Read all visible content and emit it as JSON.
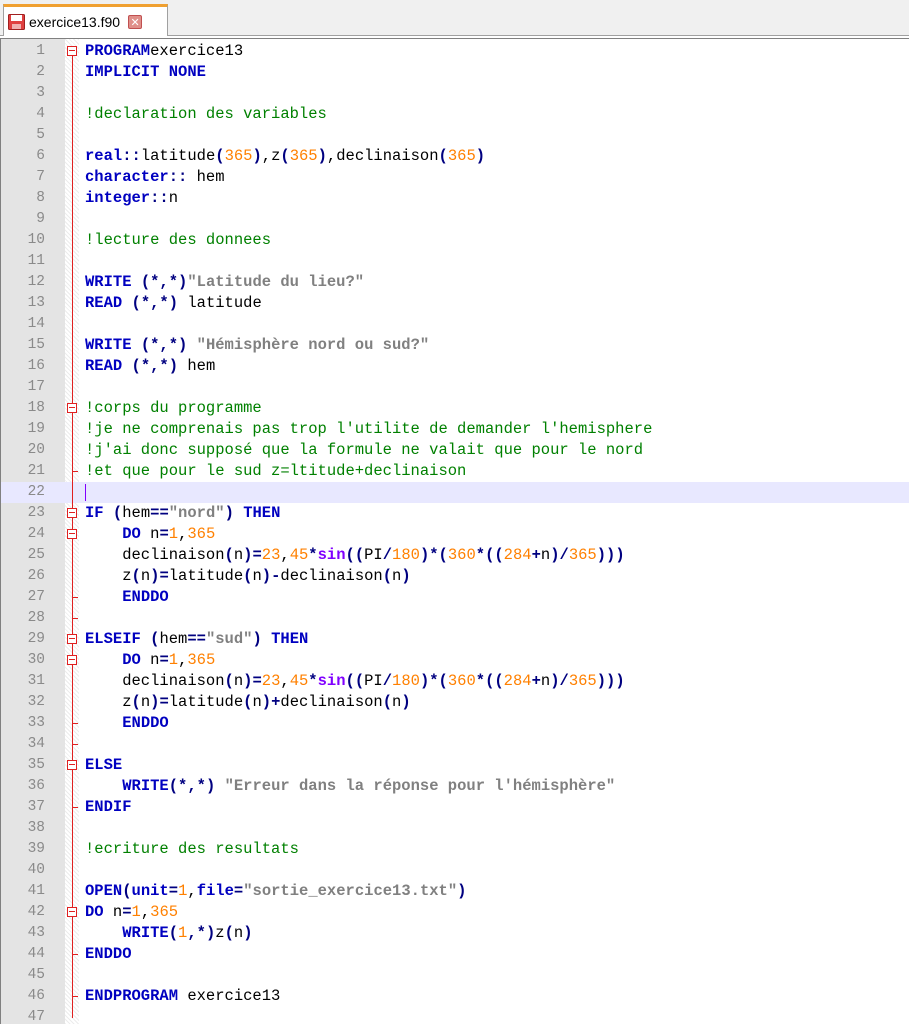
{
  "window": {
    "tab_title": "exercice13.f90",
    "tab_icon": "floppy-disk-icon",
    "close_icon": "close-icon"
  },
  "editor": {
    "current_line": 22,
    "lines": [
      {
        "n": "1",
        "t": [
          [
            "kw",
            "PROGRAM"
          ],
          [
            "",
            "exercice13"
          ]
        ]
      },
      {
        "n": "2",
        "t": [
          [
            "kw",
            "IMPLICIT NONE"
          ]
        ]
      },
      {
        "n": "3",
        "t": []
      },
      {
        "n": "4",
        "t": [
          [
            "cm",
            "!declaration des variables"
          ]
        ]
      },
      {
        "n": "5",
        "t": []
      },
      {
        "n": "6",
        "t": [
          [
            "kw",
            "real"
          ],
          [
            "op",
            "::"
          ],
          [
            "",
            "latitude"
          ],
          [
            "op",
            "("
          ],
          [
            "nm",
            "365"
          ],
          [
            "op",
            ")"
          ],
          [
            "",
            ",z"
          ],
          [
            "op",
            "("
          ],
          [
            "nm",
            "365"
          ],
          [
            "op",
            ")"
          ],
          [
            "",
            ",declinaison"
          ],
          [
            "op",
            "("
          ],
          [
            "nm",
            "365"
          ],
          [
            "op",
            ")"
          ]
        ]
      },
      {
        "n": "7",
        "t": [
          [
            "kw",
            "character"
          ],
          [
            "op",
            "::"
          ],
          [
            "",
            " hem"
          ]
        ]
      },
      {
        "n": "8",
        "t": [
          [
            "kw",
            "integer"
          ],
          [
            "op",
            "::"
          ],
          [
            "",
            "n"
          ]
        ]
      },
      {
        "n": "9",
        "t": []
      },
      {
        "n": "10",
        "t": [
          [
            "cm",
            "!lecture des donnees"
          ]
        ]
      },
      {
        "n": "11",
        "t": []
      },
      {
        "n": "12",
        "t": [
          [
            "kw",
            "WRITE"
          ],
          [
            "",
            " "
          ],
          [
            "op",
            "(*,*)"
          ],
          [
            "st",
            "\"Latitude du lieu?\""
          ]
        ]
      },
      {
        "n": "13",
        "t": [
          [
            "kw",
            "READ"
          ],
          [
            "",
            " "
          ],
          [
            "op",
            "(*,*)"
          ],
          [
            "",
            " latitude"
          ]
        ]
      },
      {
        "n": "14",
        "t": []
      },
      {
        "n": "15",
        "t": [
          [
            "kw",
            "WRITE"
          ],
          [
            "",
            " "
          ],
          [
            "op",
            "(*,*)"
          ],
          [
            "",
            " "
          ],
          [
            "st",
            "\"Hémisphère nord ou sud?\""
          ]
        ]
      },
      {
        "n": "16",
        "t": [
          [
            "kw",
            "READ"
          ],
          [
            "",
            " "
          ],
          [
            "op",
            "(*,*)"
          ],
          [
            "",
            " hem"
          ]
        ]
      },
      {
        "n": "17",
        "t": []
      },
      {
        "n": "18",
        "t": [
          [
            "cm",
            "!corps du programme"
          ]
        ]
      },
      {
        "n": "19",
        "t": [
          [
            "cm",
            "!je ne comprenais pas trop l'utilite de demander l'hemisphere"
          ]
        ]
      },
      {
        "n": "20",
        "t": [
          [
            "cm",
            "!j'ai donc supposé que la formule ne valait que pour le nord"
          ]
        ]
      },
      {
        "n": "21",
        "t": [
          [
            "cm",
            "!et que pour le sud z=ltitude+declinaison"
          ]
        ]
      },
      {
        "n": "22",
        "t": []
      },
      {
        "n": "23",
        "t": [
          [
            "kw",
            "IF"
          ],
          [
            "",
            " "
          ],
          [
            "op",
            "("
          ],
          [
            "",
            "hem"
          ],
          [
            "op",
            "=="
          ],
          [
            "st",
            "\"nord\""
          ],
          [
            "op",
            ")"
          ],
          [
            "",
            " "
          ],
          [
            "kw",
            "THEN"
          ]
        ]
      },
      {
        "n": "24",
        "t": [
          [
            "",
            "    "
          ],
          [
            "kw",
            "DO"
          ],
          [
            "",
            " n"
          ],
          [
            "op",
            "="
          ],
          [
            "nm",
            "1"
          ],
          [
            "",
            ","
          ],
          [
            "nm",
            "365"
          ]
        ]
      },
      {
        "n": "25",
        "t": [
          [
            "",
            "    declinaison"
          ],
          [
            "op",
            "("
          ],
          [
            "",
            "n"
          ],
          [
            "op",
            ")="
          ],
          [
            "nm",
            "23"
          ],
          [
            "",
            ","
          ],
          [
            "nm",
            "45"
          ],
          [
            "op",
            "*"
          ],
          [
            "fn",
            "sin"
          ],
          [
            "op",
            "(("
          ],
          [
            "",
            "PI"
          ],
          [
            "op",
            "/"
          ],
          [
            "nm",
            "180"
          ],
          [
            "op",
            ")*("
          ],
          [
            "nm",
            "360"
          ],
          [
            "op",
            "*(("
          ],
          [
            "nm",
            "284"
          ],
          [
            "op",
            "+"
          ],
          [
            "",
            "n"
          ],
          [
            "op",
            ")/"
          ],
          [
            "nm",
            "365"
          ],
          [
            "op",
            ")))"
          ]
        ]
      },
      {
        "n": "26",
        "t": [
          [
            "",
            "    z"
          ],
          [
            "op",
            "("
          ],
          [
            "",
            "n"
          ],
          [
            "op",
            ")="
          ],
          [
            "",
            "latitude"
          ],
          [
            "op",
            "("
          ],
          [
            "",
            "n"
          ],
          [
            "op",
            ")-"
          ],
          [
            "",
            "declinaison"
          ],
          [
            "op",
            "("
          ],
          [
            "",
            "n"
          ],
          [
            "op",
            ")"
          ]
        ]
      },
      {
        "n": "27",
        "t": [
          [
            "",
            "    "
          ],
          [
            "kw",
            "ENDDO"
          ]
        ]
      },
      {
        "n": "28",
        "t": []
      },
      {
        "n": "29",
        "t": [
          [
            "kw",
            "ELSEIF"
          ],
          [
            "",
            " "
          ],
          [
            "op",
            "("
          ],
          [
            "",
            "hem"
          ],
          [
            "op",
            "=="
          ],
          [
            "st",
            "\"sud\""
          ],
          [
            "op",
            ")"
          ],
          [
            "",
            " "
          ],
          [
            "kw",
            "THEN"
          ]
        ]
      },
      {
        "n": "30",
        "t": [
          [
            "",
            "    "
          ],
          [
            "kw",
            "DO"
          ],
          [
            "",
            " n"
          ],
          [
            "op",
            "="
          ],
          [
            "nm",
            "1"
          ],
          [
            "",
            ","
          ],
          [
            "nm",
            "365"
          ]
        ]
      },
      {
        "n": "31",
        "t": [
          [
            "",
            "    declinaison"
          ],
          [
            "op",
            "("
          ],
          [
            "",
            "n"
          ],
          [
            "op",
            ")="
          ],
          [
            "nm",
            "23"
          ],
          [
            "",
            ","
          ],
          [
            "nm",
            "45"
          ],
          [
            "op",
            "*"
          ],
          [
            "fn",
            "sin"
          ],
          [
            "op",
            "(("
          ],
          [
            "",
            "PI"
          ],
          [
            "op",
            "/"
          ],
          [
            "nm",
            "180"
          ],
          [
            "op",
            ")*("
          ],
          [
            "nm",
            "360"
          ],
          [
            "op",
            "*(("
          ],
          [
            "nm",
            "284"
          ],
          [
            "op",
            "+"
          ],
          [
            "",
            "n"
          ],
          [
            "op",
            ")/"
          ],
          [
            "nm",
            "365"
          ],
          [
            "op",
            ")))"
          ]
        ]
      },
      {
        "n": "32",
        "t": [
          [
            "",
            "    z"
          ],
          [
            "op",
            "("
          ],
          [
            "",
            "n"
          ],
          [
            "op",
            ")="
          ],
          [
            "",
            "latitude"
          ],
          [
            "op",
            "("
          ],
          [
            "",
            "n"
          ],
          [
            "op",
            ")+"
          ],
          [
            "",
            "declinaison"
          ],
          [
            "op",
            "("
          ],
          [
            "",
            "n"
          ],
          [
            "op",
            ")"
          ]
        ]
      },
      {
        "n": "33",
        "t": [
          [
            "",
            "    "
          ],
          [
            "kw",
            "ENDDO"
          ]
        ]
      },
      {
        "n": "34",
        "t": []
      },
      {
        "n": "35",
        "t": [
          [
            "kw",
            "ELSE"
          ]
        ]
      },
      {
        "n": "36",
        "t": [
          [
            "",
            "    "
          ],
          [
            "kw",
            "WRITE"
          ],
          [
            "op",
            "(*,*)"
          ],
          [
            "",
            " "
          ],
          [
            "st",
            "\"Erreur dans la réponse pour l'hémisphère\""
          ]
        ]
      },
      {
        "n": "37",
        "t": [
          [
            "kw",
            "ENDIF"
          ]
        ]
      },
      {
        "n": "38",
        "t": []
      },
      {
        "n": "39",
        "t": [
          [
            "cm",
            "!ecriture des resultats"
          ]
        ]
      },
      {
        "n": "40",
        "t": []
      },
      {
        "n": "41",
        "t": [
          [
            "kw",
            "OPEN"
          ],
          [
            "op",
            "("
          ],
          [
            "kw",
            "unit"
          ],
          [
            "op",
            "="
          ],
          [
            "nm",
            "1"
          ],
          [
            "",
            ","
          ],
          [
            "kw",
            "file"
          ],
          [
            "op",
            "="
          ],
          [
            "st",
            "\"sortie_exercice13.txt\""
          ],
          [
            "op",
            ")"
          ]
        ]
      },
      {
        "n": "42",
        "t": [
          [
            "kw",
            "DO"
          ],
          [
            "",
            " n"
          ],
          [
            "op",
            "="
          ],
          [
            "nm",
            "1"
          ],
          [
            "",
            ","
          ],
          [
            "nm",
            "365"
          ]
        ]
      },
      {
        "n": "43",
        "t": [
          [
            "",
            "    "
          ],
          [
            "kw",
            "WRITE"
          ],
          [
            "op",
            "("
          ],
          [
            "nm",
            "1"
          ],
          [
            "op",
            ",*)"
          ],
          [
            "",
            "z"
          ],
          [
            "op",
            "("
          ],
          [
            "",
            "n"
          ],
          [
            "op",
            ")"
          ]
        ]
      },
      {
        "n": "44",
        "t": [
          [
            "kw",
            "ENDDO"
          ]
        ]
      },
      {
        "n": "45",
        "t": []
      },
      {
        "n": "46",
        "t": [
          [
            "kw",
            "ENDPROGRAM"
          ],
          [
            "",
            " exercice13"
          ]
        ]
      },
      {
        "n": "47",
        "t": []
      }
    ]
  }
}
